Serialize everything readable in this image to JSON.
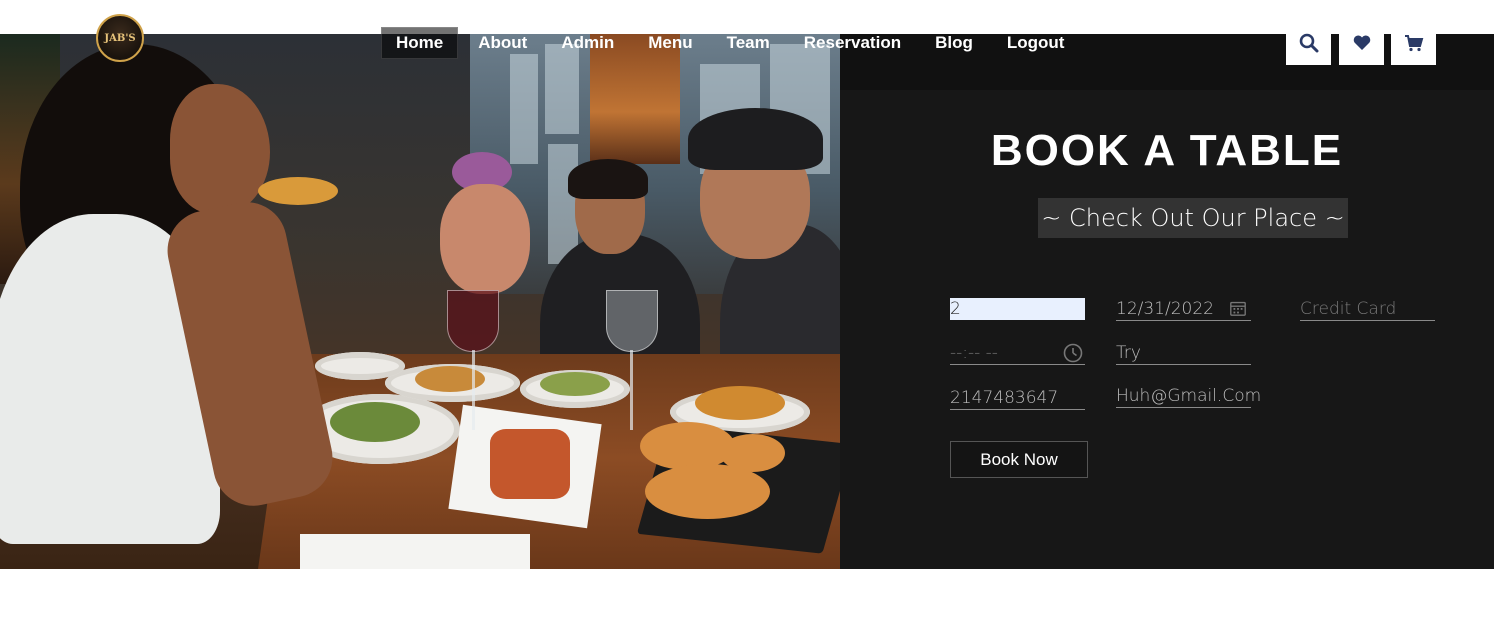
{
  "brand": {
    "logo_text": "JAB'S",
    "logo_icon": "restaurant-logo"
  },
  "nav": {
    "items": [
      {
        "label": "Home",
        "active": true
      },
      {
        "label": "About",
        "active": false
      },
      {
        "label": "Admin",
        "active": false
      },
      {
        "label": "Menu",
        "active": false
      },
      {
        "label": "Team",
        "active": false
      },
      {
        "label": "Reservation",
        "active": false
      },
      {
        "label": "Blog",
        "active": false
      },
      {
        "label": "Logout",
        "active": false
      }
    ],
    "icons": [
      {
        "name": "search-icon"
      },
      {
        "name": "heart-icon"
      },
      {
        "name": "cart-icon"
      }
    ],
    "icon_color": "#2a3a66"
  },
  "booking": {
    "title": "BOOK A TABLE",
    "subtitle": "~ Check Out Our Place ~",
    "fields": {
      "guests": {
        "value": "2"
      },
      "date": {
        "value": "12/31/2022",
        "icon": "calendar-icon"
      },
      "card": {
        "placeholder": "Credit Card"
      },
      "time": {
        "value": "--:-- --",
        "icon": "clock-icon"
      },
      "name": {
        "value": "Try"
      },
      "phone": {
        "value": "2147483647"
      },
      "email": {
        "value": "Huh@Gmail.Com"
      }
    },
    "submit_label": "Book Now"
  },
  "colors": {
    "panel_bg": "#171717",
    "subtitle_bg": "#333333",
    "guests_fill": "#e8f0fe"
  }
}
